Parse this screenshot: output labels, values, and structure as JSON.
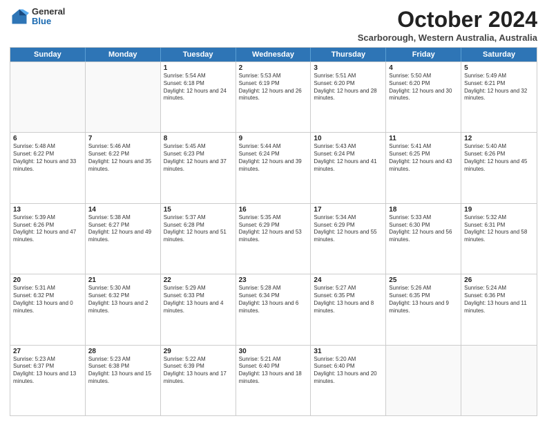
{
  "logo": {
    "general": "General",
    "blue": "Blue"
  },
  "title": {
    "month_year": "October 2024",
    "location": "Scarborough, Western Australia, Australia"
  },
  "header_days": [
    "Sunday",
    "Monday",
    "Tuesday",
    "Wednesday",
    "Thursday",
    "Friday",
    "Saturday"
  ],
  "weeks": [
    [
      {
        "day": "",
        "text": ""
      },
      {
        "day": "",
        "text": ""
      },
      {
        "day": "1",
        "text": "Sunrise: 5:54 AM\nSunset: 6:18 PM\nDaylight: 12 hours and 24 minutes."
      },
      {
        "day": "2",
        "text": "Sunrise: 5:53 AM\nSunset: 6:19 PM\nDaylight: 12 hours and 26 minutes."
      },
      {
        "day": "3",
        "text": "Sunrise: 5:51 AM\nSunset: 6:20 PM\nDaylight: 12 hours and 28 minutes."
      },
      {
        "day": "4",
        "text": "Sunrise: 5:50 AM\nSunset: 6:20 PM\nDaylight: 12 hours and 30 minutes."
      },
      {
        "day": "5",
        "text": "Sunrise: 5:49 AM\nSunset: 6:21 PM\nDaylight: 12 hours and 32 minutes."
      }
    ],
    [
      {
        "day": "6",
        "text": "Sunrise: 5:48 AM\nSunset: 6:22 PM\nDaylight: 12 hours and 33 minutes."
      },
      {
        "day": "7",
        "text": "Sunrise: 5:46 AM\nSunset: 6:22 PM\nDaylight: 12 hours and 35 minutes."
      },
      {
        "day": "8",
        "text": "Sunrise: 5:45 AM\nSunset: 6:23 PM\nDaylight: 12 hours and 37 minutes."
      },
      {
        "day": "9",
        "text": "Sunrise: 5:44 AM\nSunset: 6:24 PM\nDaylight: 12 hours and 39 minutes."
      },
      {
        "day": "10",
        "text": "Sunrise: 5:43 AM\nSunset: 6:24 PM\nDaylight: 12 hours and 41 minutes."
      },
      {
        "day": "11",
        "text": "Sunrise: 5:41 AM\nSunset: 6:25 PM\nDaylight: 12 hours and 43 minutes."
      },
      {
        "day": "12",
        "text": "Sunrise: 5:40 AM\nSunset: 6:26 PM\nDaylight: 12 hours and 45 minutes."
      }
    ],
    [
      {
        "day": "13",
        "text": "Sunrise: 5:39 AM\nSunset: 6:26 PM\nDaylight: 12 hours and 47 minutes."
      },
      {
        "day": "14",
        "text": "Sunrise: 5:38 AM\nSunset: 6:27 PM\nDaylight: 12 hours and 49 minutes."
      },
      {
        "day": "15",
        "text": "Sunrise: 5:37 AM\nSunset: 6:28 PM\nDaylight: 12 hours and 51 minutes."
      },
      {
        "day": "16",
        "text": "Sunrise: 5:35 AM\nSunset: 6:29 PM\nDaylight: 12 hours and 53 minutes."
      },
      {
        "day": "17",
        "text": "Sunrise: 5:34 AM\nSunset: 6:29 PM\nDaylight: 12 hours and 55 minutes."
      },
      {
        "day": "18",
        "text": "Sunrise: 5:33 AM\nSunset: 6:30 PM\nDaylight: 12 hours and 56 minutes."
      },
      {
        "day": "19",
        "text": "Sunrise: 5:32 AM\nSunset: 6:31 PM\nDaylight: 12 hours and 58 minutes."
      }
    ],
    [
      {
        "day": "20",
        "text": "Sunrise: 5:31 AM\nSunset: 6:32 PM\nDaylight: 13 hours and 0 minutes."
      },
      {
        "day": "21",
        "text": "Sunrise: 5:30 AM\nSunset: 6:32 PM\nDaylight: 13 hours and 2 minutes."
      },
      {
        "day": "22",
        "text": "Sunrise: 5:29 AM\nSunset: 6:33 PM\nDaylight: 13 hours and 4 minutes."
      },
      {
        "day": "23",
        "text": "Sunrise: 5:28 AM\nSunset: 6:34 PM\nDaylight: 13 hours and 6 minutes."
      },
      {
        "day": "24",
        "text": "Sunrise: 5:27 AM\nSunset: 6:35 PM\nDaylight: 13 hours and 8 minutes."
      },
      {
        "day": "25",
        "text": "Sunrise: 5:26 AM\nSunset: 6:35 PM\nDaylight: 13 hours and 9 minutes."
      },
      {
        "day": "26",
        "text": "Sunrise: 5:24 AM\nSunset: 6:36 PM\nDaylight: 13 hours and 11 minutes."
      }
    ],
    [
      {
        "day": "27",
        "text": "Sunrise: 5:23 AM\nSunset: 6:37 PM\nDaylight: 13 hours and 13 minutes."
      },
      {
        "day": "28",
        "text": "Sunrise: 5:23 AM\nSunset: 6:38 PM\nDaylight: 13 hours and 15 minutes."
      },
      {
        "day": "29",
        "text": "Sunrise: 5:22 AM\nSunset: 6:39 PM\nDaylight: 13 hours and 17 minutes."
      },
      {
        "day": "30",
        "text": "Sunrise: 5:21 AM\nSunset: 6:40 PM\nDaylight: 13 hours and 18 minutes."
      },
      {
        "day": "31",
        "text": "Sunrise: 5:20 AM\nSunset: 6:40 PM\nDaylight: 13 hours and 20 minutes."
      },
      {
        "day": "",
        "text": ""
      },
      {
        "day": "",
        "text": ""
      }
    ]
  ]
}
